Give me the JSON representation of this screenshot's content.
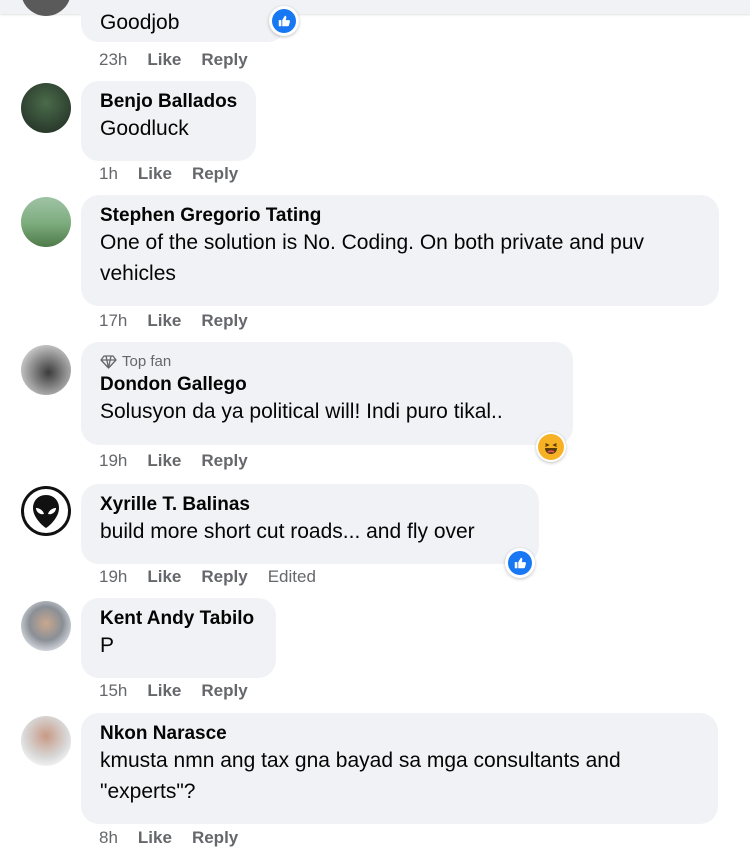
{
  "comments": [
    {
      "name": "",
      "text": "Goodjob",
      "time": "23h",
      "like": "Like",
      "reply": "Reply",
      "edited": "",
      "reaction": "like"
    },
    {
      "name": "Benjo Ballados",
      "text": "Goodluck",
      "time": "1h",
      "like": "Like",
      "reply": "Reply",
      "edited": "",
      "reaction": ""
    },
    {
      "name": "Stephen Gregorio Tating",
      "text": "One of the solution is No. Coding. On both private and puv vehicles",
      "time": "17h",
      "like": "Like",
      "reply": "Reply",
      "edited": "",
      "reaction": ""
    },
    {
      "badge": "Top fan",
      "name": "Dondon Gallego",
      "text": "Solusyon da ya political will! Indi puro tikal..",
      "time": "19h",
      "like": "Like",
      "reply": "Reply",
      "edited": "",
      "reaction": "haha"
    },
    {
      "name": "Xyrille T. Balinas",
      "text": "build more short cut roads... and fly over",
      "time": "19h",
      "like": "Like",
      "reply": "Reply",
      "edited": "Edited",
      "reaction": "like"
    },
    {
      "name": "Kent Andy Tabilo",
      "text": "P",
      "time": "15h",
      "like": "Like",
      "reply": "Reply",
      "edited": "",
      "reaction": ""
    },
    {
      "name": "Nkon Narasce",
      "text": "kmusta nmn ang tax gna bayad sa mga consultants and \"experts\"?",
      "time": "8h",
      "like": "Like",
      "reply": "Reply",
      "edited": "",
      "reaction": ""
    }
  ],
  "colors": {
    "bubble": "#f0f2f5",
    "secondary_text": "#65676b",
    "like_blue": "#1877f2",
    "haha_yellow": "#f7b125"
  },
  "icons": {
    "like_reaction": "thumbs-up-icon",
    "haha_reaction": "laughing-face-icon",
    "top_fan_badge": "diamond-icon"
  }
}
